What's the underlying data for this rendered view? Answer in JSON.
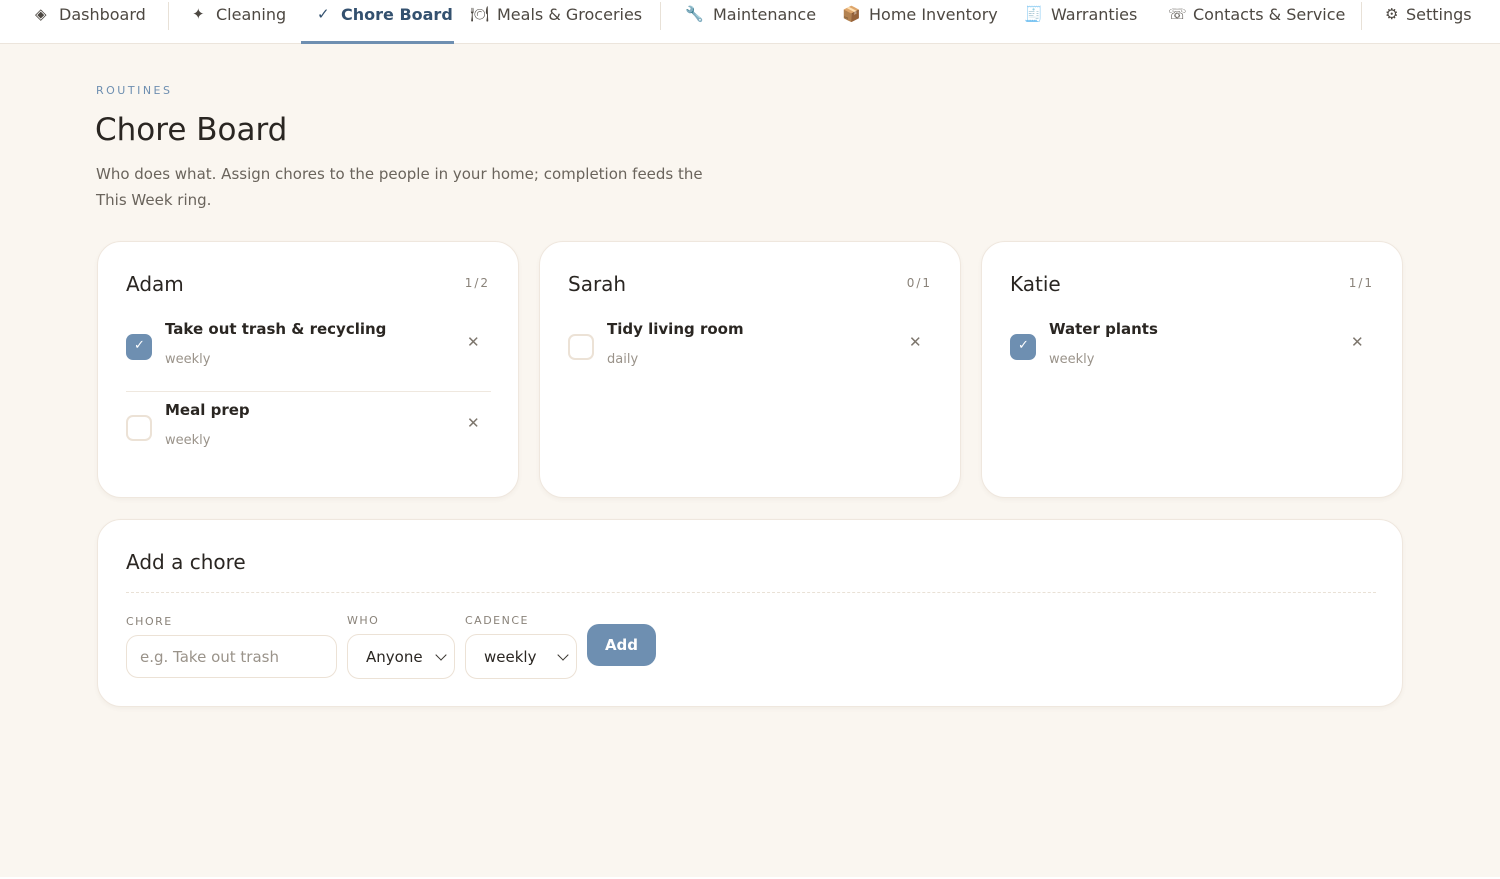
{
  "nav": {
    "items": [
      {
        "icon": "◈",
        "label": "Dashboard",
        "icon_name": "dashboard-icon"
      },
      {
        "icon": "✦",
        "label": "Cleaning",
        "icon_name": "sparkle-icon"
      },
      {
        "icon": "✓",
        "label": "Chore Board",
        "icon_name": "check-icon",
        "active": true
      },
      {
        "icon": "🍽",
        "label": "Meals & Groceries",
        "icon_name": "plate-icon"
      },
      {
        "icon": "🔧",
        "label": "Maintenance",
        "icon_name": "wrench-icon"
      },
      {
        "icon": "📦",
        "label": "Home Inventory",
        "icon_name": "box-icon"
      },
      {
        "icon": "🧾",
        "label": "Warranties",
        "icon_name": "receipt-icon"
      },
      {
        "icon": "☏",
        "label": "Contacts & Service",
        "icon_name": "phone-icon"
      },
      {
        "icon": "⚙",
        "label": "Settings",
        "icon_name": "gear-icon"
      }
    ]
  },
  "header": {
    "eyebrow": "ROUTINES",
    "title": "Chore Board",
    "description": "Who does what. Assign chores to the people in your home; completion feeds the This Week ring."
  },
  "people": [
    {
      "name": "Adam",
      "count": "1/2",
      "chores": [
        {
          "title": "Take out trash & recycling",
          "cadence": "weekly",
          "done": true
        },
        {
          "title": "Meal prep",
          "cadence": "weekly",
          "done": false
        }
      ]
    },
    {
      "name": "Sarah",
      "count": "0/1",
      "chores": [
        {
          "title": "Tidy living room",
          "cadence": "daily",
          "done": false
        }
      ]
    },
    {
      "name": "Katie",
      "count": "1/1",
      "chores": [
        {
          "title": "Water plants",
          "cadence": "weekly",
          "done": true
        }
      ]
    }
  ],
  "add_chore": {
    "title": "Add a chore",
    "chore_label": "CHORE",
    "chore_placeholder": "e.g. Take out trash",
    "who_label": "WHO",
    "who_value": "Anyone",
    "cadence_label": "CADENCE",
    "cadence_value": "weekly",
    "add_label": "Add"
  },
  "colors": {
    "accent": "#6e8fb1",
    "background": "#faf6f0",
    "active_nav_text": "#34516f"
  },
  "remove_glyph": "✕"
}
